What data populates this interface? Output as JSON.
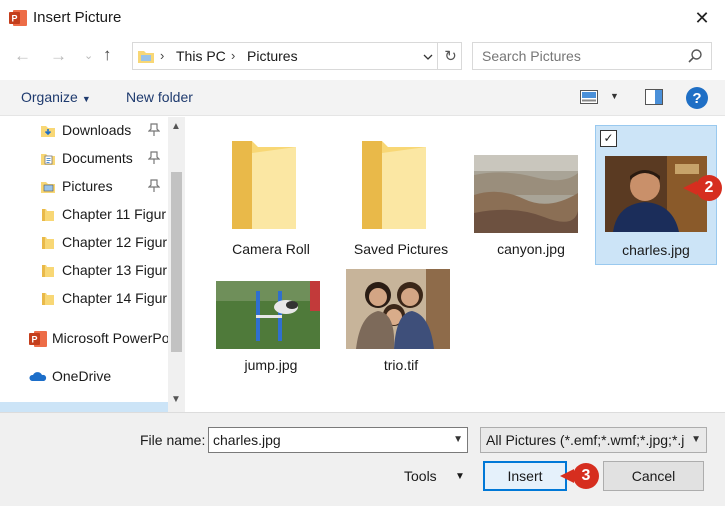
{
  "window": {
    "title": "Insert Picture",
    "close_glyph": "✕"
  },
  "nav": {
    "back_glyph": "←",
    "forward_glyph": "→",
    "recent_glyph": "⌄",
    "up_glyph": "↑",
    "breadcrumb": [
      "This PC",
      "Pictures"
    ],
    "breadcrumb_sep": "›",
    "refresh_glyph": "↻",
    "search_placeholder": "Search Pictures"
  },
  "toolbar": {
    "organize_label": "Organize",
    "new_folder_label": "New folder",
    "help_label": "?"
  },
  "sidebar": {
    "items": [
      {
        "label": "Downloads",
        "icon": "download-folder-icon",
        "pinned": true
      },
      {
        "label": "Documents",
        "icon": "documents-folder-icon",
        "pinned": true
      },
      {
        "label": "Pictures",
        "icon": "pictures-folder-icon",
        "pinned": true
      },
      {
        "label": "Chapter 11 Figur",
        "icon": "folder-icon",
        "pinned": false
      },
      {
        "label": "Chapter 12 Figur",
        "icon": "folder-icon",
        "pinned": false
      },
      {
        "label": "Chapter 13 Figur",
        "icon": "folder-icon",
        "pinned": false
      },
      {
        "label": "Chapter 14 Figur",
        "icon": "folder-icon",
        "pinned": false
      },
      {
        "label": "Microsoft PowerPo",
        "icon": "powerpoint-icon",
        "pinned": false
      },
      {
        "label": "OneDrive",
        "icon": "onedrive-icon",
        "pinned": false
      }
    ]
  },
  "files": [
    {
      "name": "Camera Roll",
      "kind": "folder"
    },
    {
      "name": "Saved Pictures",
      "kind": "folder"
    },
    {
      "name": "canyon.jpg",
      "kind": "image"
    },
    {
      "name": "charles.jpg",
      "kind": "image",
      "selected": true
    },
    {
      "name": "jump.jpg",
      "kind": "image"
    },
    {
      "name": "trio.tif",
      "kind": "image"
    }
  ],
  "footer": {
    "file_name_label": "File name:",
    "file_name_value": "charles.jpg",
    "filter_value": "All Pictures (*.emf;*.wmf;*.jpg;*.j",
    "tools_label": "Tools",
    "insert_label": "Insert",
    "cancel_label": "Cancel"
  },
  "callouts": {
    "step2": "2",
    "step3": "3"
  },
  "colors": {
    "accent": "#0078d7",
    "selection": "#cce4f7",
    "callout": "#d62e1f",
    "folder": "#f8d775"
  }
}
